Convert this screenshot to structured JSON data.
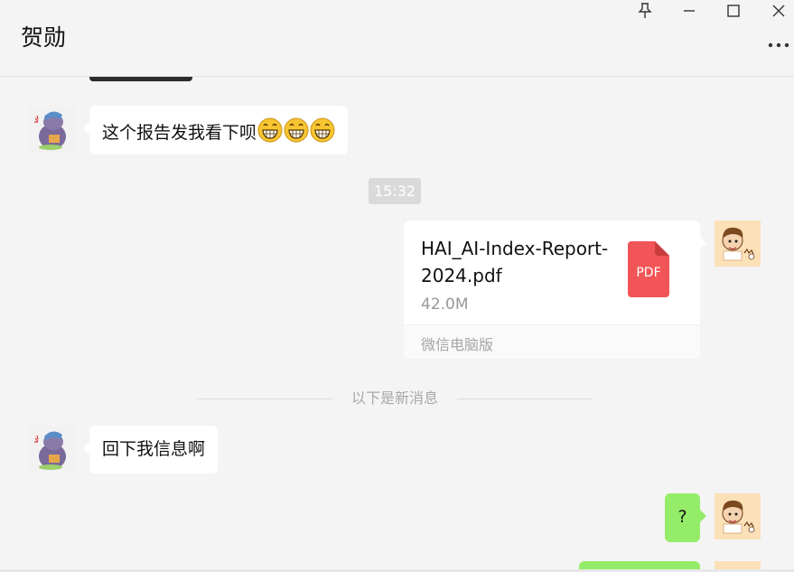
{
  "window": {
    "title": "贺勋",
    "controls": [
      "pin-icon",
      "minimize-icon",
      "maximize-icon",
      "close-icon"
    ],
    "more_icon": "more-dots-icon"
  },
  "messages": [
    {
      "type": "received",
      "text": "这个报告发我看下呗",
      "emoji": [
        "grin-emoji",
        "grin-emoji",
        "grin-emoji"
      ]
    },
    {
      "type": "timestamp",
      "text": "15:32"
    },
    {
      "type": "sent-file",
      "file_name": "HAI_AI-Index-Report-2024.pdf",
      "file_size": "42.0M",
      "file_badge": "PDF",
      "source": "微信电脑版"
    },
    {
      "type": "divider",
      "text": "以下是新消息"
    },
    {
      "type": "received",
      "text": "回下我信息啊"
    },
    {
      "type": "sent",
      "text": "?"
    }
  ],
  "colors": {
    "background": "#f4f4f4",
    "sent_bubble": "#95ec69",
    "received_bubble": "#ffffff",
    "pdf_icon": "#f25557"
  }
}
